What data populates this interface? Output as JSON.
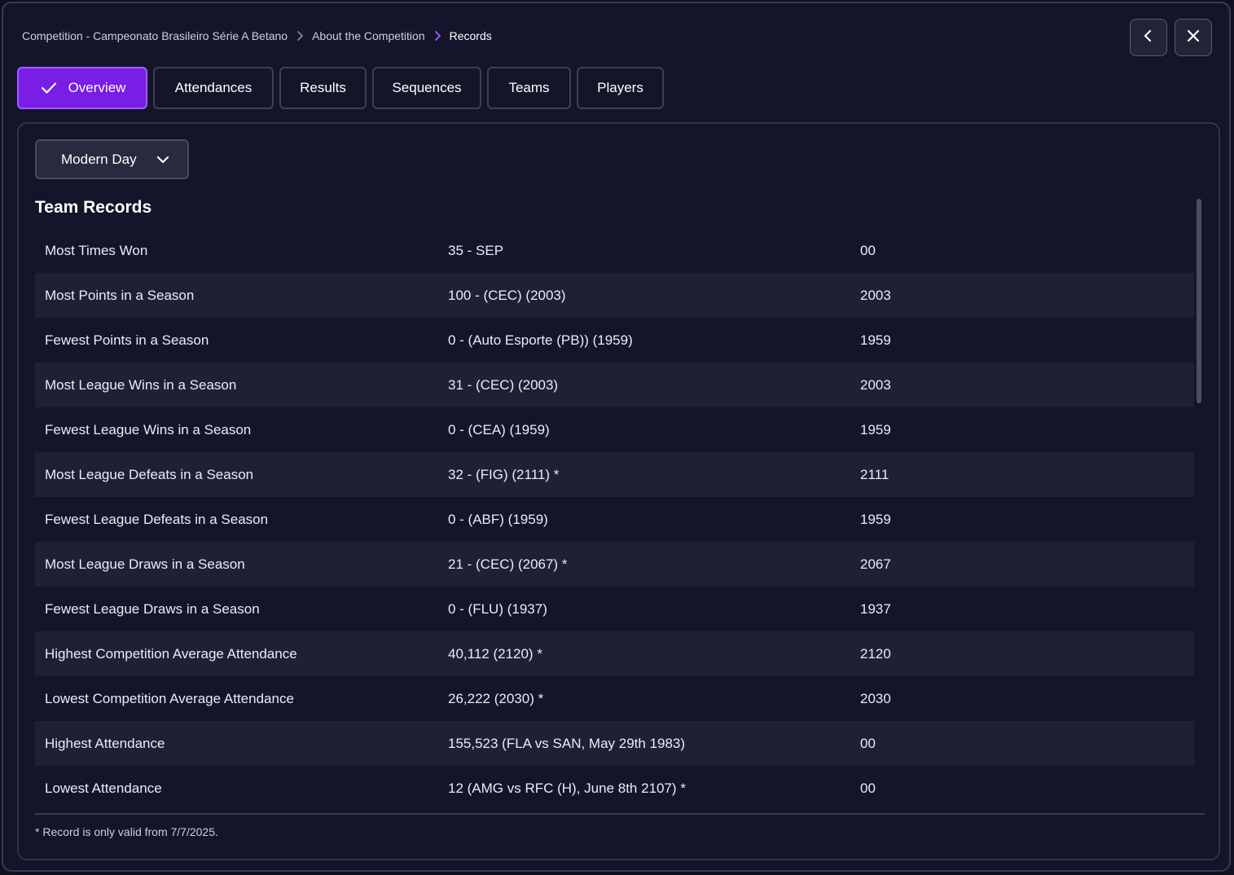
{
  "breadcrumb": {
    "items": [
      "Competition - Campeonato Brasileiro Série A Betano",
      "About the Competition",
      "Records"
    ]
  },
  "window_buttons": {
    "back_icon": "chevron-left-icon",
    "close_icon": "close-icon"
  },
  "tabs": [
    {
      "label": "Overview",
      "active": true
    },
    {
      "label": "Attendances",
      "active": false
    },
    {
      "label": "Results",
      "active": false
    },
    {
      "label": "Sequences",
      "active": false
    },
    {
      "label": "Teams",
      "active": false
    },
    {
      "label": "Players",
      "active": false
    }
  ],
  "filter": {
    "selected": "Modern Day"
  },
  "section": {
    "title": "Team Records"
  },
  "records": [
    {
      "name": "Most Times Won",
      "value": "35 - SEP",
      "year": "00"
    },
    {
      "name": "Most Points in a Season",
      "value": "100 - (CEC) (2003)",
      "year": "2003"
    },
    {
      "name": "Fewest Points in a Season",
      "value": "0 - (Auto Esporte (PB)) (1959)",
      "year": "1959"
    },
    {
      "name": "Most League Wins in a Season",
      "value": "31 - (CEC) (2003)",
      "year": "2003"
    },
    {
      "name": "Fewest League Wins in a Season",
      "value": "0 - (CEA) (1959)",
      "year": "1959"
    },
    {
      "name": "Most League Defeats in a Season",
      "value": "32 - (FIG) (2111) *",
      "year": "2111"
    },
    {
      "name": "Fewest League Defeats in a Season",
      "value": "0 - (ABF) (1959)",
      "year": "1959"
    },
    {
      "name": "Most League Draws in a Season",
      "value": "21 - (CEC) (2067) *",
      "year": "2067"
    },
    {
      "name": "Fewest League Draws in a Season",
      "value": "0 - (FLU) (1937)",
      "year": "1937"
    },
    {
      "name": "Highest Competition Average Attendance",
      "value": "40,112 (2120) *",
      "year": "2120"
    },
    {
      "name": "Lowest Competition Average Attendance",
      "value": "26,222 (2030) *",
      "year": "2030"
    },
    {
      "name": "Highest Attendance",
      "value": "155,523 (FLA vs SAN, May 29th 1983)",
      "year": "00"
    },
    {
      "name": "Lowest Attendance",
      "value": "12 (AMG vs RFC (H), June 8th 2107) *",
      "year": "00"
    }
  ],
  "footnote": "* Record is only valid from 7/7/2025.",
  "colors": {
    "accent": "#7a1de6",
    "background": "#14142a",
    "row_alt": "#1f1f36"
  }
}
